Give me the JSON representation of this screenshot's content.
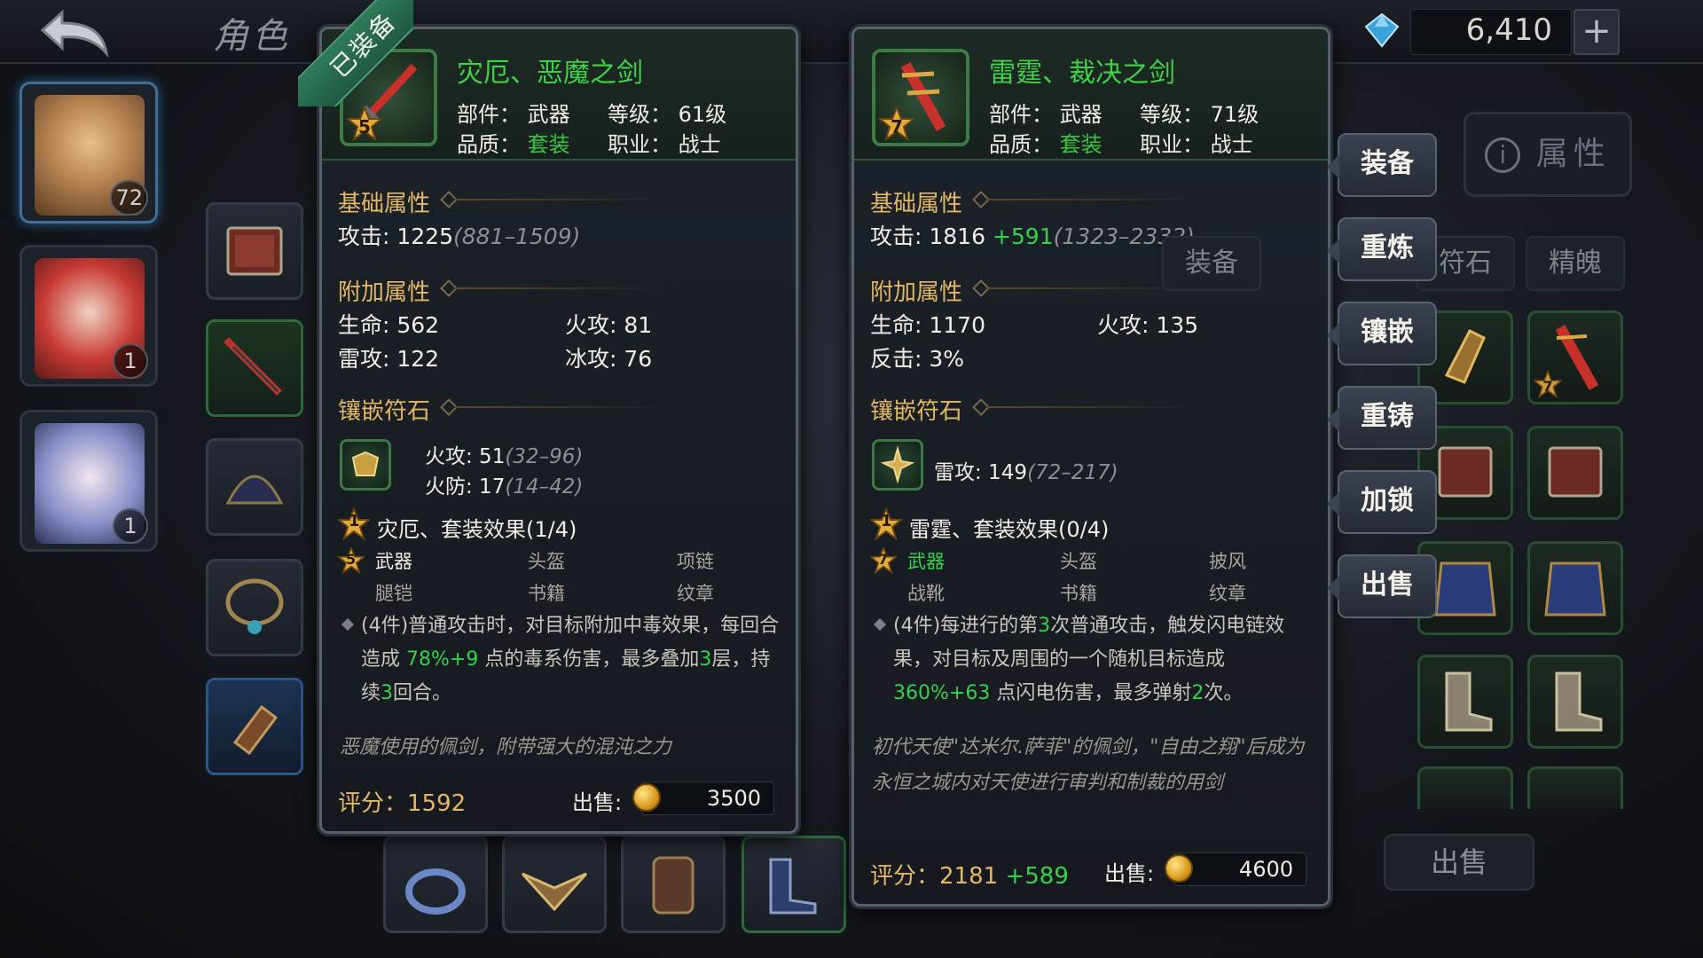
{
  "header": {
    "title": "角色",
    "currency_value": "6,410",
    "add_label": "+"
  },
  "heroes": [
    {
      "level": "72"
    },
    {
      "level": "1"
    },
    {
      "level": "1"
    }
  ],
  "equipped_badge": "已装备",
  "left_item": {
    "name": "灾厄、恶魔之剑",
    "star": "5",
    "slot_label": "部件：",
    "slot_value": "武器",
    "level_label": "等级：",
    "level_value": "61级",
    "quality_label": "品质：",
    "quality_value": "套装",
    "class_label": "职业：",
    "class_value": "战士",
    "base_title": "基础属性",
    "attack_label": "攻击: 1225",
    "attack_range": "(881–1509)",
    "extra_title": "附加属性",
    "extra": [
      {
        "text": "生命: 562"
      },
      {
        "text": "火攻: 81"
      },
      {
        "text": "雷攻: 122"
      },
      {
        "text": "冰攻: 76"
      }
    ],
    "rune_title": "镶嵌符石",
    "rune_lines": [
      {
        "text": "火攻: 51",
        "range": "(32–96)"
      },
      {
        "text": "火防: 17",
        "range": "(14–42)"
      }
    ],
    "set_num": "1",
    "set_title": "灾厄、套装效果(1/4)",
    "set_star": "5",
    "set_items": [
      "武器",
      "头盔",
      "项链",
      "腿铠",
      "书籍",
      "纹章"
    ],
    "set_desc_a": "(4件)普通攻击时，对目标附加中毒效果，每回合造成 ",
    "set_desc_b": "78%+9",
    "set_desc_c": " 点的毒系伤害，最多叠加",
    "set_desc_d": "3",
    "set_desc_e": "层，持续",
    "set_desc_f": "3",
    "set_desc_g": "回合。",
    "flavor": "恶魔使用的佩剑，附带强大的混沌之力",
    "score_label": "评分：",
    "score_value": "1592",
    "sell_label": "出售:",
    "sell_price": "3500"
  },
  "right_item": {
    "name": "雷霆、裁决之剑",
    "star": "7",
    "slot_label": "部件：",
    "slot_value": "武器",
    "level_label": "等级：",
    "level_value": "71级",
    "quality_label": "品质：",
    "quality_value": "套装",
    "class_label": "职业：",
    "class_value": "战士",
    "base_title": "基础属性",
    "attack_label": "攻击: 1816",
    "attack_bonus": " +591",
    "attack_range": "(1323–2332)",
    "extra_title": "附加属性",
    "extra": [
      {
        "text": "生命: 1170"
      },
      {
        "text": "火攻: 135"
      },
      {
        "text": "反击: 3%"
      }
    ],
    "rune_title": "镶嵌符石",
    "rune_lines": [
      {
        "text": "雷攻: 149",
        "range": "(72–217)"
      }
    ],
    "set_num": "1",
    "set_title": "雷霆、套装效果(0/4)",
    "set_star": "7",
    "set_items": [
      "武器",
      "头盔",
      "披风",
      "战靴",
      "书籍",
      "纹章"
    ],
    "set_desc_a": "(4件)每进行的第",
    "set_desc_b": "3",
    "set_desc_c": "次普通攻击，触发闪电链效果，对目标及周围的一个随机目标造成 ",
    "set_desc_d": "360%+63",
    "set_desc_e": " 点闪电伤害，最多弹射",
    "set_desc_f": "2",
    "set_desc_g": "次。",
    "flavor": "初代天使\"达米尔.萨菲\"的佩剑，\"自由之翔\"后成为永恒之城内对天使进行审判和制裁的用剑",
    "score_label": "评分：",
    "score_value": "2181",
    "score_bonus": " +589",
    "sell_label": "出售:",
    "sell_price": "4600"
  },
  "actions": [
    "装备",
    "重炼",
    "镶嵌",
    "重铸",
    "加锁",
    "出售"
  ],
  "attr_tab": "属性",
  "sub_tabs": [
    "装备",
    "符石",
    "精魄"
  ],
  "inventory_star": "7",
  "sell_all": "出售",
  "colors": {
    "green": "#35d14a",
    "gold": "#e2b765",
    "border_green": "#3a7d44"
  },
  "icons": [
    "back-arrow-icon",
    "gem-icon",
    "plus-icon",
    "info-icon",
    "gold-coin-icon",
    "star-icon",
    "rune-icon"
  ]
}
